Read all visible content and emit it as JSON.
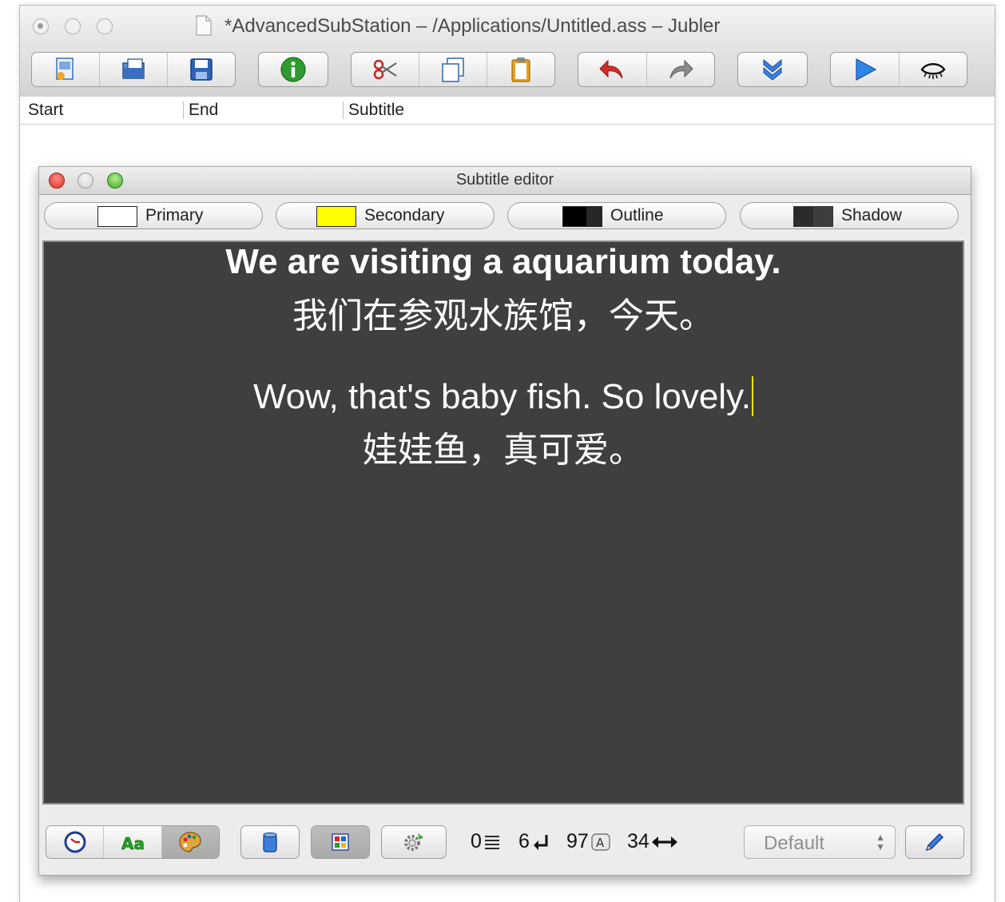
{
  "window": {
    "title": "*AdvancedSubStation – /Applications/Untitled.ass – Jubler"
  },
  "toolbar": {
    "groups": [
      [
        "new-file-icon",
        "open-file-icon",
        "save-icon"
      ],
      [
        "info-icon"
      ],
      [
        "cut-icon",
        "copy-icon",
        "paste-icon"
      ],
      [
        "undo-icon",
        "redo-icon"
      ],
      [
        "jump-down-icon"
      ],
      [
        "play-icon",
        "preview-eye-icon"
      ]
    ]
  },
  "table": {
    "columns": [
      "Start",
      "End",
      "Subtitle"
    ]
  },
  "editor": {
    "title": "Subtitle editor",
    "color_buttons": [
      {
        "label": "Primary",
        "color": "#ffffff"
      },
      {
        "label": "Secondary",
        "color": "#ffff00"
      },
      {
        "label": "Outline",
        "color": "#000000"
      },
      {
        "label": "Shadow",
        "color": "#333333"
      }
    ],
    "preview": {
      "line1": "We are visiting a aquarium today.",
      "line2": "我们在参观水族馆，今天。",
      "line3": "Wow, that's baby fish. So lovely.",
      "line4": "娃娃鱼，真可爱。"
    },
    "stats": {
      "lines": "0",
      "newlines": "6",
      "chars": "97",
      "width": "34"
    },
    "style_select": {
      "value": "Default"
    }
  },
  "colors": {
    "preview_bg": "#3f3f3f",
    "cursor": "#f5e400",
    "close_button": "#d8312a",
    "zoom_button": "#44a52a"
  }
}
